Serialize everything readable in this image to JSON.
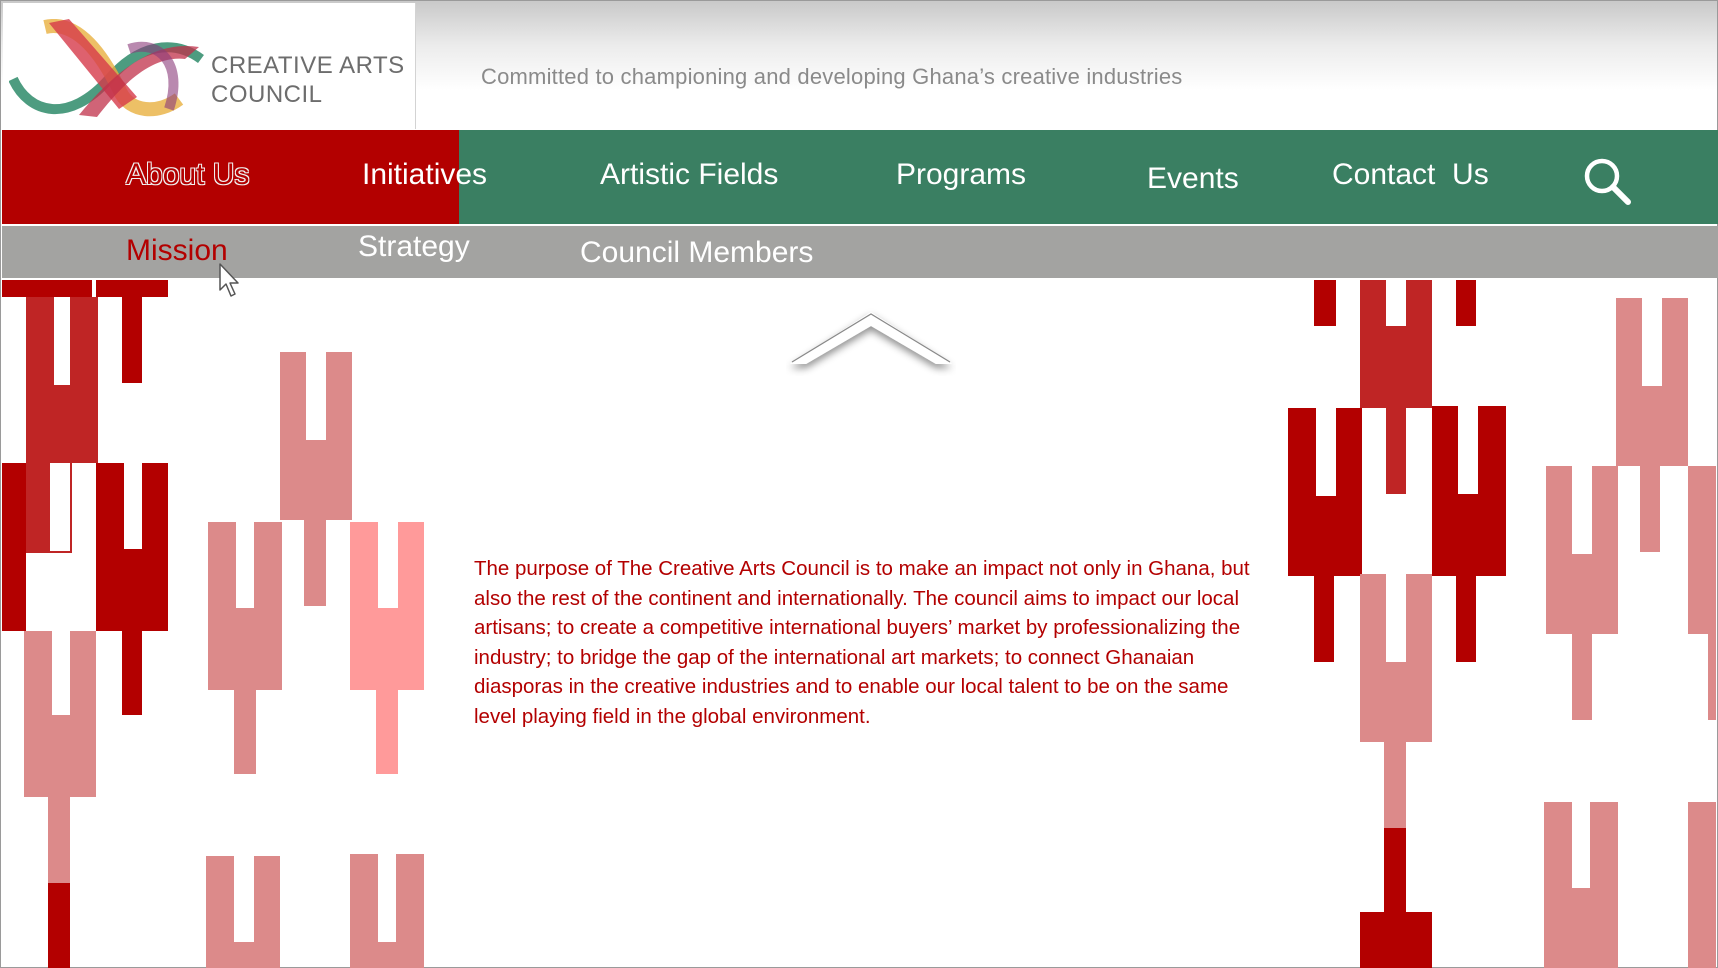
{
  "header": {
    "logo_line1": "CREATIVE ARTS",
    "logo_line2": "COUNCIL",
    "tagline": "Committed to championing and developing Ghana’s creative industries"
  },
  "nav": {
    "items": [
      {
        "label": "About Us",
        "active": true
      },
      {
        "label": "Initiatives",
        "active": false
      },
      {
        "label": "Artistic Fields",
        "active": false
      },
      {
        "label": "Programs",
        "active": false
      },
      {
        "label": "Events",
        "active": false
      },
      {
        "label": "Contact  Us",
        "active": false
      }
    ],
    "search_icon": "search-icon"
  },
  "subnav": {
    "items": [
      {
        "label": "Mission",
        "active": true
      },
      {
        "label": "Strategy",
        "active": false
      },
      {
        "label": "Council Members",
        "active": false
      }
    ]
  },
  "content": {
    "mission_text": "The purpose of The Creative Arts Council is to make an impact not only in Ghana, but also the rest of the continent and internationally. The council aims to impact our local artisans; to create a competitive international buyers’ market by professionalizing the industry; to bridge the gap of the international art markets; to connect Ghanaian diasporas in the creative industries and to enable our local talent to be on the same level playing field in the global environment."
  },
  "colors": {
    "brand_red": "#b30000",
    "nav_green": "#3a7f62",
    "subnav_gray": "#a3a3a1",
    "pattern_red": "#b30000",
    "pattern_mid_red": "#bf2525",
    "pattern_pink": "#dc8a8a",
    "pattern_light_pink": "#ff9a9a"
  }
}
